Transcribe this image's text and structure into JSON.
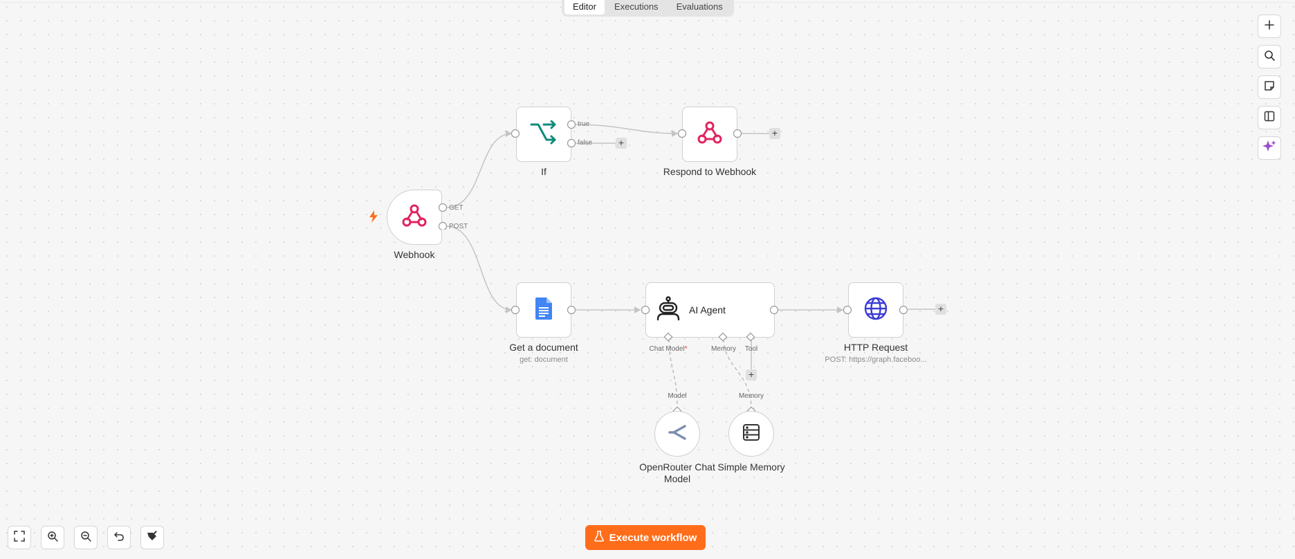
{
  "tabs": [
    {
      "label": "Editor",
      "active": true
    },
    {
      "label": "Executions",
      "active": false
    },
    {
      "label": "Evaluations",
      "active": false
    }
  ],
  "nodes": {
    "webhook": {
      "title": "Webhook",
      "outputs": [
        "GET",
        "POST"
      ],
      "icon": "webhook-icon"
    },
    "if": {
      "title": "If",
      "outputs": [
        "true",
        "false"
      ],
      "icon": "if-branch-icon"
    },
    "respond": {
      "title": "Respond to Webhook",
      "icon": "webhook-icon"
    },
    "get_document": {
      "title": "Get a document",
      "subtitle": "get: document",
      "icon": "google-docs-icon"
    },
    "ai_agent": {
      "title": "AI Agent",
      "ports": {
        "chat_model": "Chat Model",
        "required_mark": "*",
        "memory": "Memory",
        "tool": "Tool"
      },
      "icon": "robot-icon"
    },
    "http_request": {
      "title": "HTTP Request",
      "subtitle": "POST: https://graph.faceboo...",
      "icon": "globe-icon"
    },
    "openrouter": {
      "title_line1": "OpenRouter Chat",
      "title_line2": "Model",
      "port": "Model",
      "icon": "openrouter-icon"
    },
    "simple_memory": {
      "title": "Simple Memory",
      "port": "Memory",
      "icon": "database-icon"
    }
  },
  "plus_symbol": "+",
  "execute_button": {
    "label": "Execute workflow",
    "icon": "flask-icon"
  },
  "right_toolbar": [
    "add-node-icon",
    "search-icon",
    "sticky-note-icon",
    "panel-toggle-icon",
    "ai-sparkle-icon"
  ],
  "bottom_toolbar": [
    "fit-view-icon",
    "zoom-in-icon",
    "zoom-out-icon",
    "undo-icon",
    "tidy-up-icon"
  ],
  "colors": {
    "accent": "#ff6d1a",
    "webhook": "#e0245e",
    "if": "#0f8a7a",
    "docs": "#4285f4",
    "globe": "#3b3bd6",
    "sparkle": "#9b4dca"
  }
}
